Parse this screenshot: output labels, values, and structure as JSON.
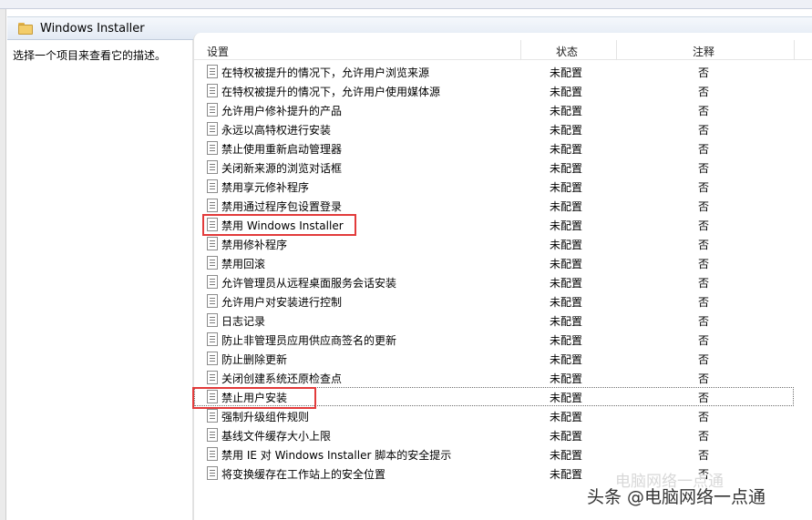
{
  "window": {
    "title": "Windows Installer"
  },
  "description_pane": {
    "text": "选择一个项目来查看它的描述。"
  },
  "columns": {
    "setting": "设置",
    "status": "状态",
    "note": "注释"
  },
  "rows": [
    {
      "name": "在特权被提升的情况下，允许用户浏览来源",
      "status": "未配置",
      "note": "否"
    },
    {
      "name": "在特权被提升的情况下，允许用户使用媒体源",
      "status": "未配置",
      "note": "否"
    },
    {
      "name": "允许用户修补提升的产品",
      "status": "未配置",
      "note": "否"
    },
    {
      "name": "永远以高特权进行安装",
      "status": "未配置",
      "note": "否"
    },
    {
      "name": "禁止使用重新启动管理器",
      "status": "未配置",
      "note": "否"
    },
    {
      "name": "关闭新来源的浏览对话框",
      "status": "未配置",
      "note": "否"
    },
    {
      "name": "禁用享元修补程序",
      "status": "未配置",
      "note": "否"
    },
    {
      "name": "禁用通过程序包设置登录",
      "status": "未配置",
      "note": "否"
    },
    {
      "name": "禁用 Windows Installer",
      "status": "未配置",
      "note": "否"
    },
    {
      "name": "禁用修补程序",
      "status": "未配置",
      "note": "否"
    },
    {
      "name": "禁用回滚",
      "status": "未配置",
      "note": "否"
    },
    {
      "name": "允许管理员从远程桌面服务会话安装",
      "status": "未配置",
      "note": "否"
    },
    {
      "name": "允许用户对安装进行控制",
      "status": "未配置",
      "note": "否"
    },
    {
      "name": "日志记录",
      "status": "未配置",
      "note": "否"
    },
    {
      "name": "防止非管理员应用供应商签名的更新",
      "status": "未配置",
      "note": "否"
    },
    {
      "name": "防止删除更新",
      "status": "未配置",
      "note": "否"
    },
    {
      "name": "关闭创建系统还原检查点",
      "status": "未配置",
      "note": "否"
    },
    {
      "name": "禁止用户安装",
      "status": "未配置",
      "note": "否"
    },
    {
      "name": "强制升级组件规则",
      "status": "未配置",
      "note": "否"
    },
    {
      "name": "基线文件缓存大小上限",
      "status": "未配置",
      "note": "否"
    },
    {
      "name": "禁用 IE 对 Windows Installer 脚本的安全提示",
      "status": "未配置",
      "note": "否"
    },
    {
      "name": "将变换缓存在工作站上的安全位置",
      "status": "未配置",
      "note": "否"
    }
  ],
  "selected_row_index": 17,
  "highlight_color": "#e23b3b",
  "watermark": {
    "text": "头条 @电脑网络一点通",
    "faint_text": "电脑网络一点通"
  }
}
